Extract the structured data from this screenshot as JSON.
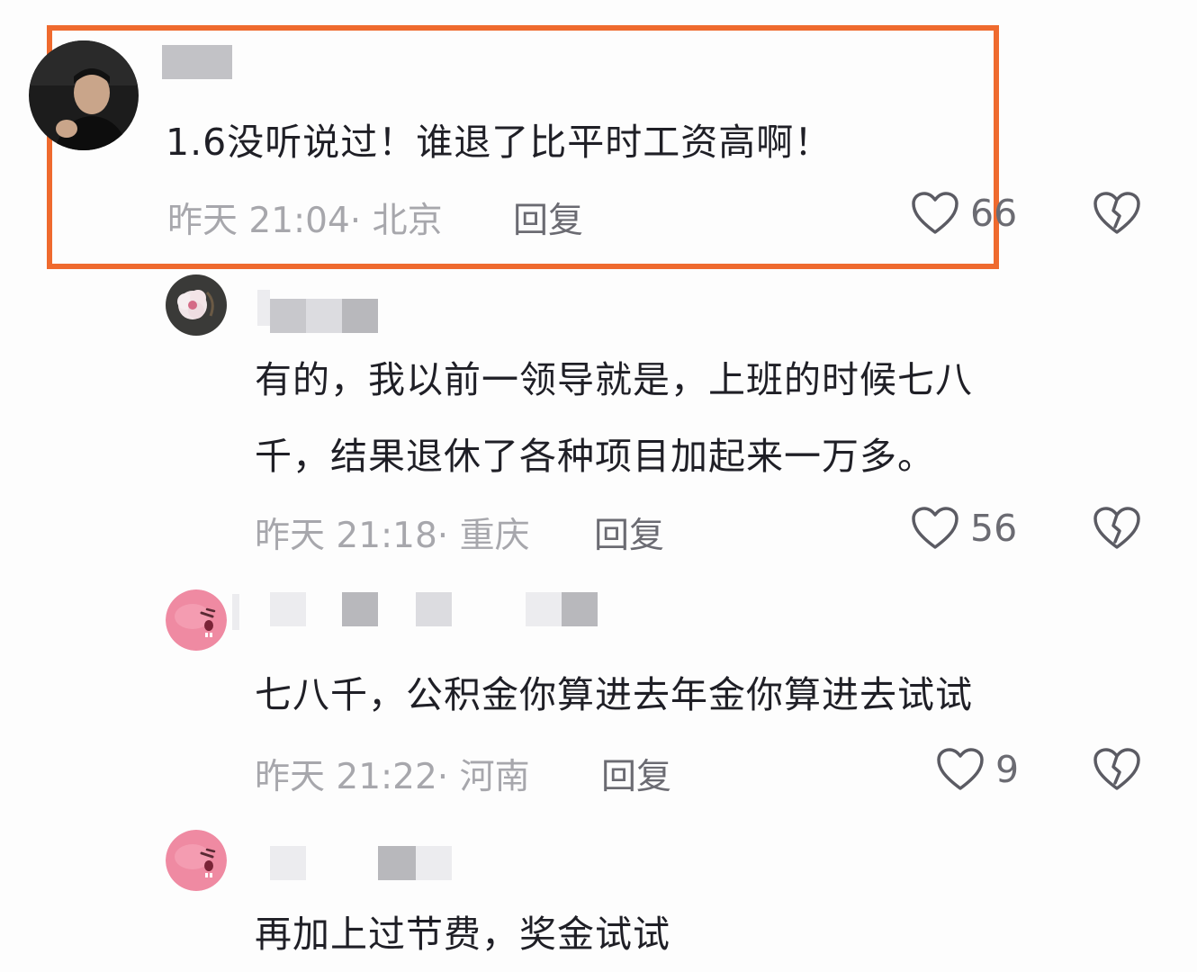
{
  "comments": [
    {
      "text": "1.6没听说过！谁退了比平时工资高啊！",
      "time": "昨天 21:04",
      "location": "· 北京",
      "reply_label": "回复",
      "likes": "66"
    },
    {
      "text_line1": "有的，我以前一领导就是，上班的时候七八",
      "text_line2": "千，结果退休了各种项目加起来一万多。",
      "time": "昨天 21:18",
      "location": "· 重庆",
      "reply_label": "回复",
      "likes": "56"
    },
    {
      "text": "七八千，公积金你算进去年金你算进去试试",
      "time": "昨天 21:22",
      "location": "· 河南",
      "reply_label": "回复",
      "likes": "9"
    },
    {
      "text": "再加上过节费，奖金试试"
    }
  ],
  "colors": {
    "highlight": "#ef6a2e",
    "meta": "#a7a7ac",
    "text": "#1f1f26"
  },
  "icons": {
    "like": "heart-outline-icon",
    "dislike": "broken-heart-icon"
  }
}
